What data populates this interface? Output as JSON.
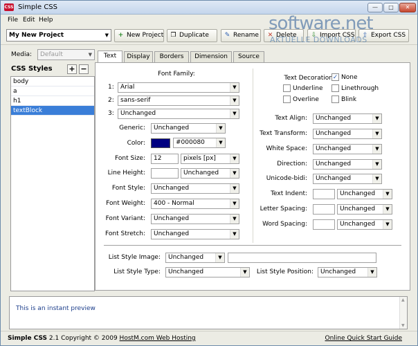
{
  "window": {
    "title": "Simple CSS",
    "app_icon": "CSS"
  },
  "window_controls": {
    "minimize": "—",
    "maximize": "□",
    "close": "✕"
  },
  "menu": [
    "File",
    "Edit",
    "Help"
  ],
  "toolbar": {
    "project": "My New Project",
    "buttons": {
      "new": "New Project",
      "duplicate": "Duplicate",
      "rename": "Rename",
      "delete": "Delete",
      "import": "Import CSS",
      "export": "Export CSS"
    },
    "icons": {
      "new": "+",
      "duplicate": "❐",
      "rename": "✎",
      "delete": "✕",
      "import": "⇩",
      "export": "⇧"
    }
  },
  "watermark": {
    "main": "software.net",
    "sub": "AKTUELLE DOWNLOADS"
  },
  "sidebar": {
    "media_label": "Media:",
    "media_value": "Default",
    "title": "CSS Styles",
    "add": "+",
    "remove": "−",
    "items": [
      "body",
      "a",
      "h1",
      "textBlock"
    ],
    "selected_index": 3
  },
  "tabs": [
    "Text",
    "Display",
    "Borders",
    "Dimension",
    "Source"
  ],
  "active_tab": "Text",
  "text_tab": {
    "font_family_label": "Font Family:",
    "font_family": [
      {
        "num": "1:",
        "value": "Arial"
      },
      {
        "num": "2:",
        "value": "sans-serif"
      },
      {
        "num": "3:",
        "value": "Unchanged"
      }
    ],
    "generic": {
      "label": "Generic:",
      "value": "Unchanged"
    },
    "color": {
      "label": "Color:",
      "value": "#000080",
      "swatch": "#000080"
    },
    "font_size": {
      "label": "Font Size:",
      "value": "12",
      "unit": "pixels [px]"
    },
    "line_height": {
      "label": "Line Height:",
      "value": "",
      "unit": "Unchanged"
    },
    "font_style": {
      "label": "Font Style:",
      "value": "Unchanged"
    },
    "font_weight": {
      "label": "Font Weight:",
      "value": "400 - Normal"
    },
    "font_variant": {
      "label": "Font Variant:",
      "value": "Unchanged"
    },
    "font_stretch": {
      "label": "Font Stretch:",
      "value": "Unchanged"
    },
    "decoration": {
      "label": "Text Decoration:",
      "options": [
        {
          "label": "None",
          "checked": true
        },
        {
          "label": "Underline",
          "checked": false
        },
        {
          "label": "Linethrough",
          "checked": false
        },
        {
          "label": "Overline",
          "checked": false
        },
        {
          "label": "Blink",
          "checked": false
        }
      ]
    },
    "text_align": {
      "label": "Text Align:",
      "value": "Unchanged"
    },
    "text_transform": {
      "label": "Text Transform:",
      "value": "Unchanged"
    },
    "white_space": {
      "label": "White Space:",
      "value": "Unchanged"
    },
    "direction": {
      "label": "Direction:",
      "value": "Unchanged"
    },
    "unicode_bidi": {
      "label": "Unicode-bidi:",
      "value": "Unchanged"
    },
    "text_indent": {
      "label": "Text Indent:",
      "value": "",
      "unit": "Unchanged"
    },
    "letter_spacing": {
      "label": "Letter Spacing:",
      "value": "",
      "unit": "Unchanged"
    },
    "word_spacing": {
      "label": "Word Spacing:",
      "value": "",
      "unit": "Unchanged"
    },
    "list_style_image": {
      "label": "List Style Image:",
      "value": "Unchanged",
      "url": ""
    },
    "list_style_type": {
      "label": "List Style Type:",
      "value": "Unchanged"
    },
    "list_style_position": {
      "label": "List Style Position:",
      "value": "Unchanged"
    }
  },
  "preview": {
    "text": "This is an instant preview"
  },
  "status": {
    "app_name": "Simple CSS",
    "copyright": " 2.1 Copyright © 2009 ",
    "link": "HostM.com Web Hosting",
    "right_link": "Online Quick Start Guide"
  }
}
